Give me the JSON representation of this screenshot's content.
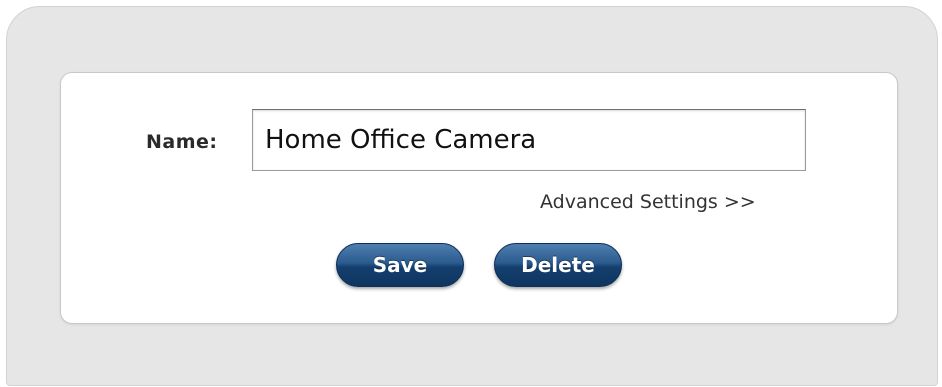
{
  "form": {
    "name_label": "Name:",
    "name_value": "Home Office Camera",
    "advanced_link": "Advanced Settings >>",
    "save_label": "Save",
    "delete_label": "Delete"
  },
  "colors": {
    "panel_bg": "#e6e6e6",
    "card_bg": "#ffffff",
    "button_blue": "#1d4a7c"
  }
}
